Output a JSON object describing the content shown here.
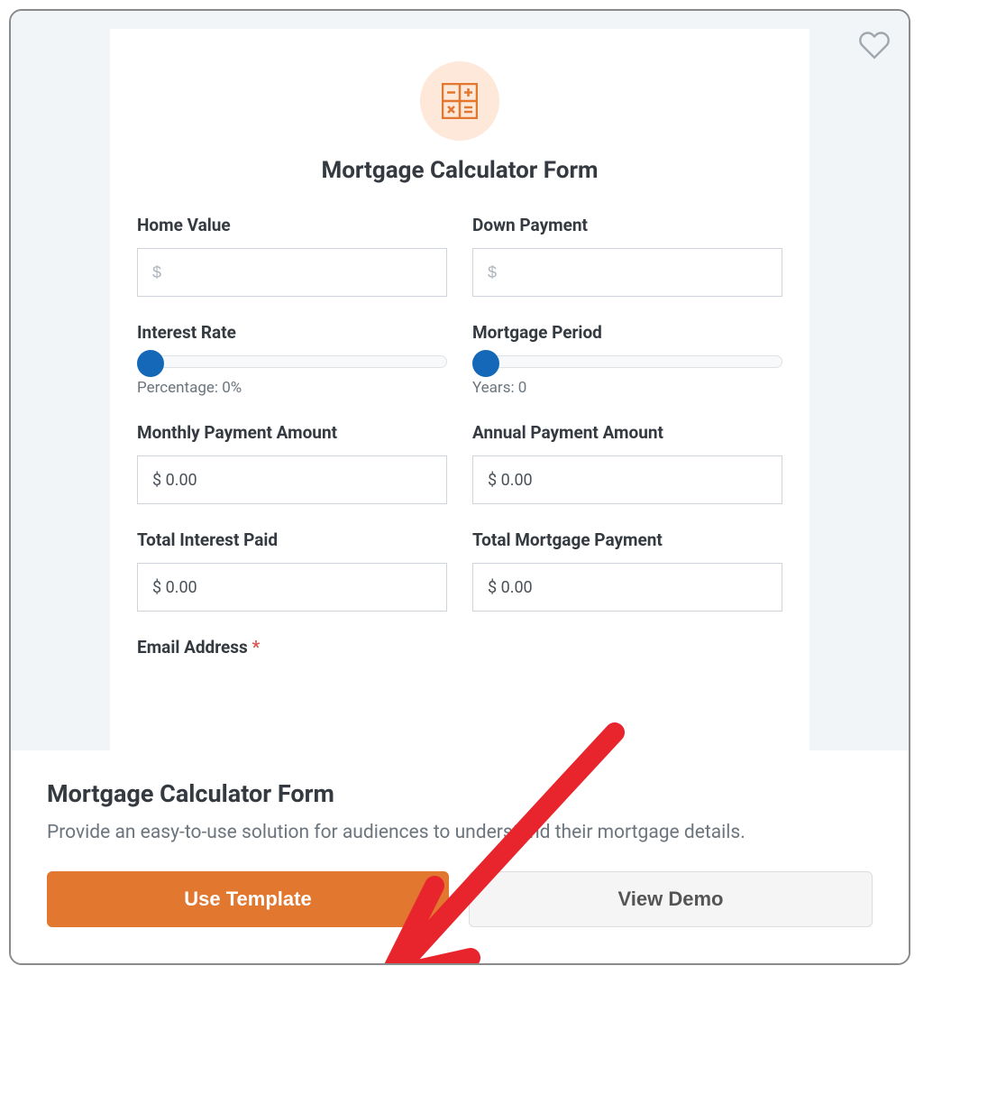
{
  "form": {
    "title": "Mortgage Calculator Form",
    "fields": {
      "homeValue": {
        "label": "Home Value",
        "placeholder": "$"
      },
      "downPayment": {
        "label": "Down Payment",
        "placeholder": "$"
      },
      "interestRate": {
        "label": "Interest Rate",
        "sliderText": "Percentage: 0%"
      },
      "mortgagePeriod": {
        "label": "Mortgage Period",
        "sliderText": "Years: 0"
      },
      "monthlyPayment": {
        "label": "Monthly Payment Amount",
        "value": "$ 0.00"
      },
      "annualPayment": {
        "label": "Annual Payment Amount",
        "value": "$ 0.00"
      },
      "totalInterest": {
        "label": "Total Interest Paid",
        "value": "$ 0.00"
      },
      "totalMortgage": {
        "label": "Total Mortgage Payment",
        "value": "$ 0.00"
      },
      "email": {
        "label": "Email Address",
        "required": "*"
      }
    }
  },
  "info": {
    "title": "Mortgage Calculator Form",
    "description": "Provide an easy-to-use solution for audiences to understand their mortgage details."
  },
  "buttons": {
    "useTemplate": "Use Template",
    "viewDemo": "View Demo"
  }
}
